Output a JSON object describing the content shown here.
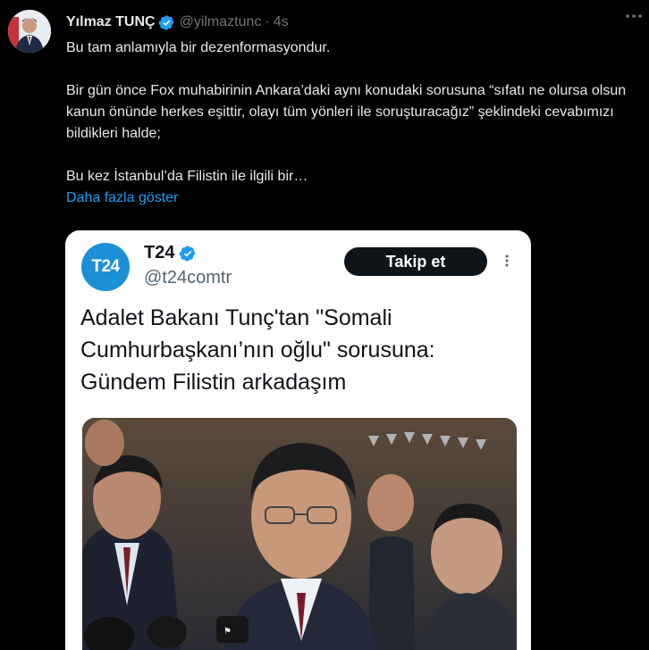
{
  "tweet": {
    "author": {
      "display_name": "Yılmaz TUNÇ",
      "handle": "@yilmaztunc",
      "verified": true
    },
    "separator": "·",
    "timestamp": "4s",
    "text_paragraphs": [
      "Bu tam anlamıyla bir dezenformasyondur.",
      "Bir gün önce Fox muhabirinin Ankara’daki aynı konudaki sorusuna “sıfatı ne olursa olsun kanun önünde herkes eşittir, olayı tüm yönleri ile soruşturacağız” şeklindeki cevabımızı bildikleri halde;",
      "Bu kez İstanbul’da Filistin ile ilgili bir…"
    ],
    "show_more_label": "Daha fazla göster",
    "icons": [
      "avatar",
      "verified-badge-icon",
      "more-icon"
    ]
  },
  "quoted_card": {
    "logo_text": "T24",
    "name": "T24",
    "handle": "@t24comtr",
    "verified": true,
    "follow_label": "Takip et",
    "headline": "Adalet Bakanı Tunç'tan \"Somali Cumhurbaşkanı’nın oğlu\" sorusuna: Gündem Filistin arkadaşım",
    "icons": [
      "verified-badge-icon",
      "vertical-more-icon"
    ]
  },
  "colors": {
    "background": "#000000",
    "text": "#e7e9ea",
    "muted": "#71767b",
    "link": "#1d9bf0",
    "verified": "#1d9bf0",
    "t24_blue": "#1d8fd4",
    "follow_button": "#0f1419"
  }
}
